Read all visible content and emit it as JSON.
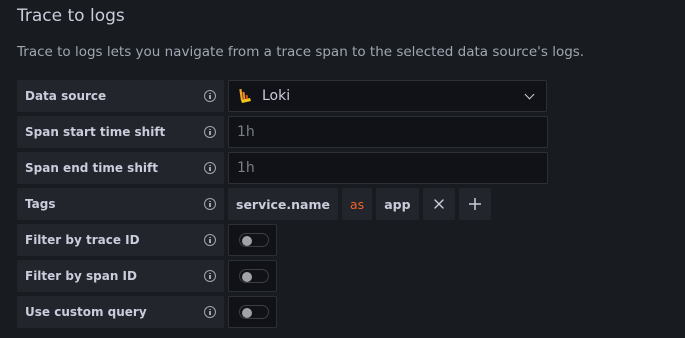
{
  "section": {
    "title": "Trace to logs",
    "description": "Trace to logs lets you navigate from a trace span to the selected data source's logs."
  },
  "fields": {
    "data_source": {
      "label": "Data source",
      "value": "Loki"
    },
    "span_start": {
      "label": "Span start time shift",
      "placeholder": "1h"
    },
    "span_end": {
      "label": "Span end time shift",
      "placeholder": "1h"
    },
    "tags": {
      "label": "Tags",
      "key": "service.name",
      "operator": "as",
      "alias": "app"
    },
    "filter_trace_id": {
      "label": "Filter by trace ID",
      "enabled": false
    },
    "filter_span_id": {
      "label": "Filter by span ID",
      "enabled": false
    },
    "custom_query": {
      "label": "Use custom query",
      "enabled": false
    }
  },
  "colors": {
    "background": "#181b1f",
    "label_bg": "#22252b",
    "input_bg": "#111217",
    "operator_accent": "#f0652b"
  },
  "icons": {
    "info": "info-circle-icon",
    "data_source": "loki-logo",
    "dropdown": "chevron-down-icon",
    "remove": "close-icon",
    "add": "plus-icon"
  }
}
